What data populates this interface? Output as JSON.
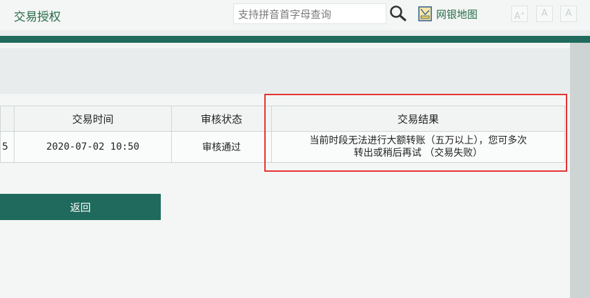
{
  "header": {
    "title": "交易授权",
    "search_placeholder": "支持拼音首字母查询",
    "sitemap_label": "网银地图",
    "font_controls": {
      "increase": "A",
      "normal": "A",
      "decrease": "A",
      "plus_mark": "+"
    }
  },
  "table": {
    "partial_first_cell": "5",
    "columns": {
      "time": "交易时间",
      "review": "审核状态",
      "result": "交易结果"
    },
    "row": {
      "time": "2020-07-02 10:50",
      "review": "审核通过",
      "result_line1": "当前时段无法进行大额转账（五万以上），您可多次",
      "result_line2": "转出或稍后再试 （交易失败）"
    }
  },
  "actions": {
    "return_label": "返回"
  },
  "colors": {
    "brand_green": "#1f6a5c",
    "title_green": "#2a6b4a",
    "highlight_red": "#e5312e"
  }
}
